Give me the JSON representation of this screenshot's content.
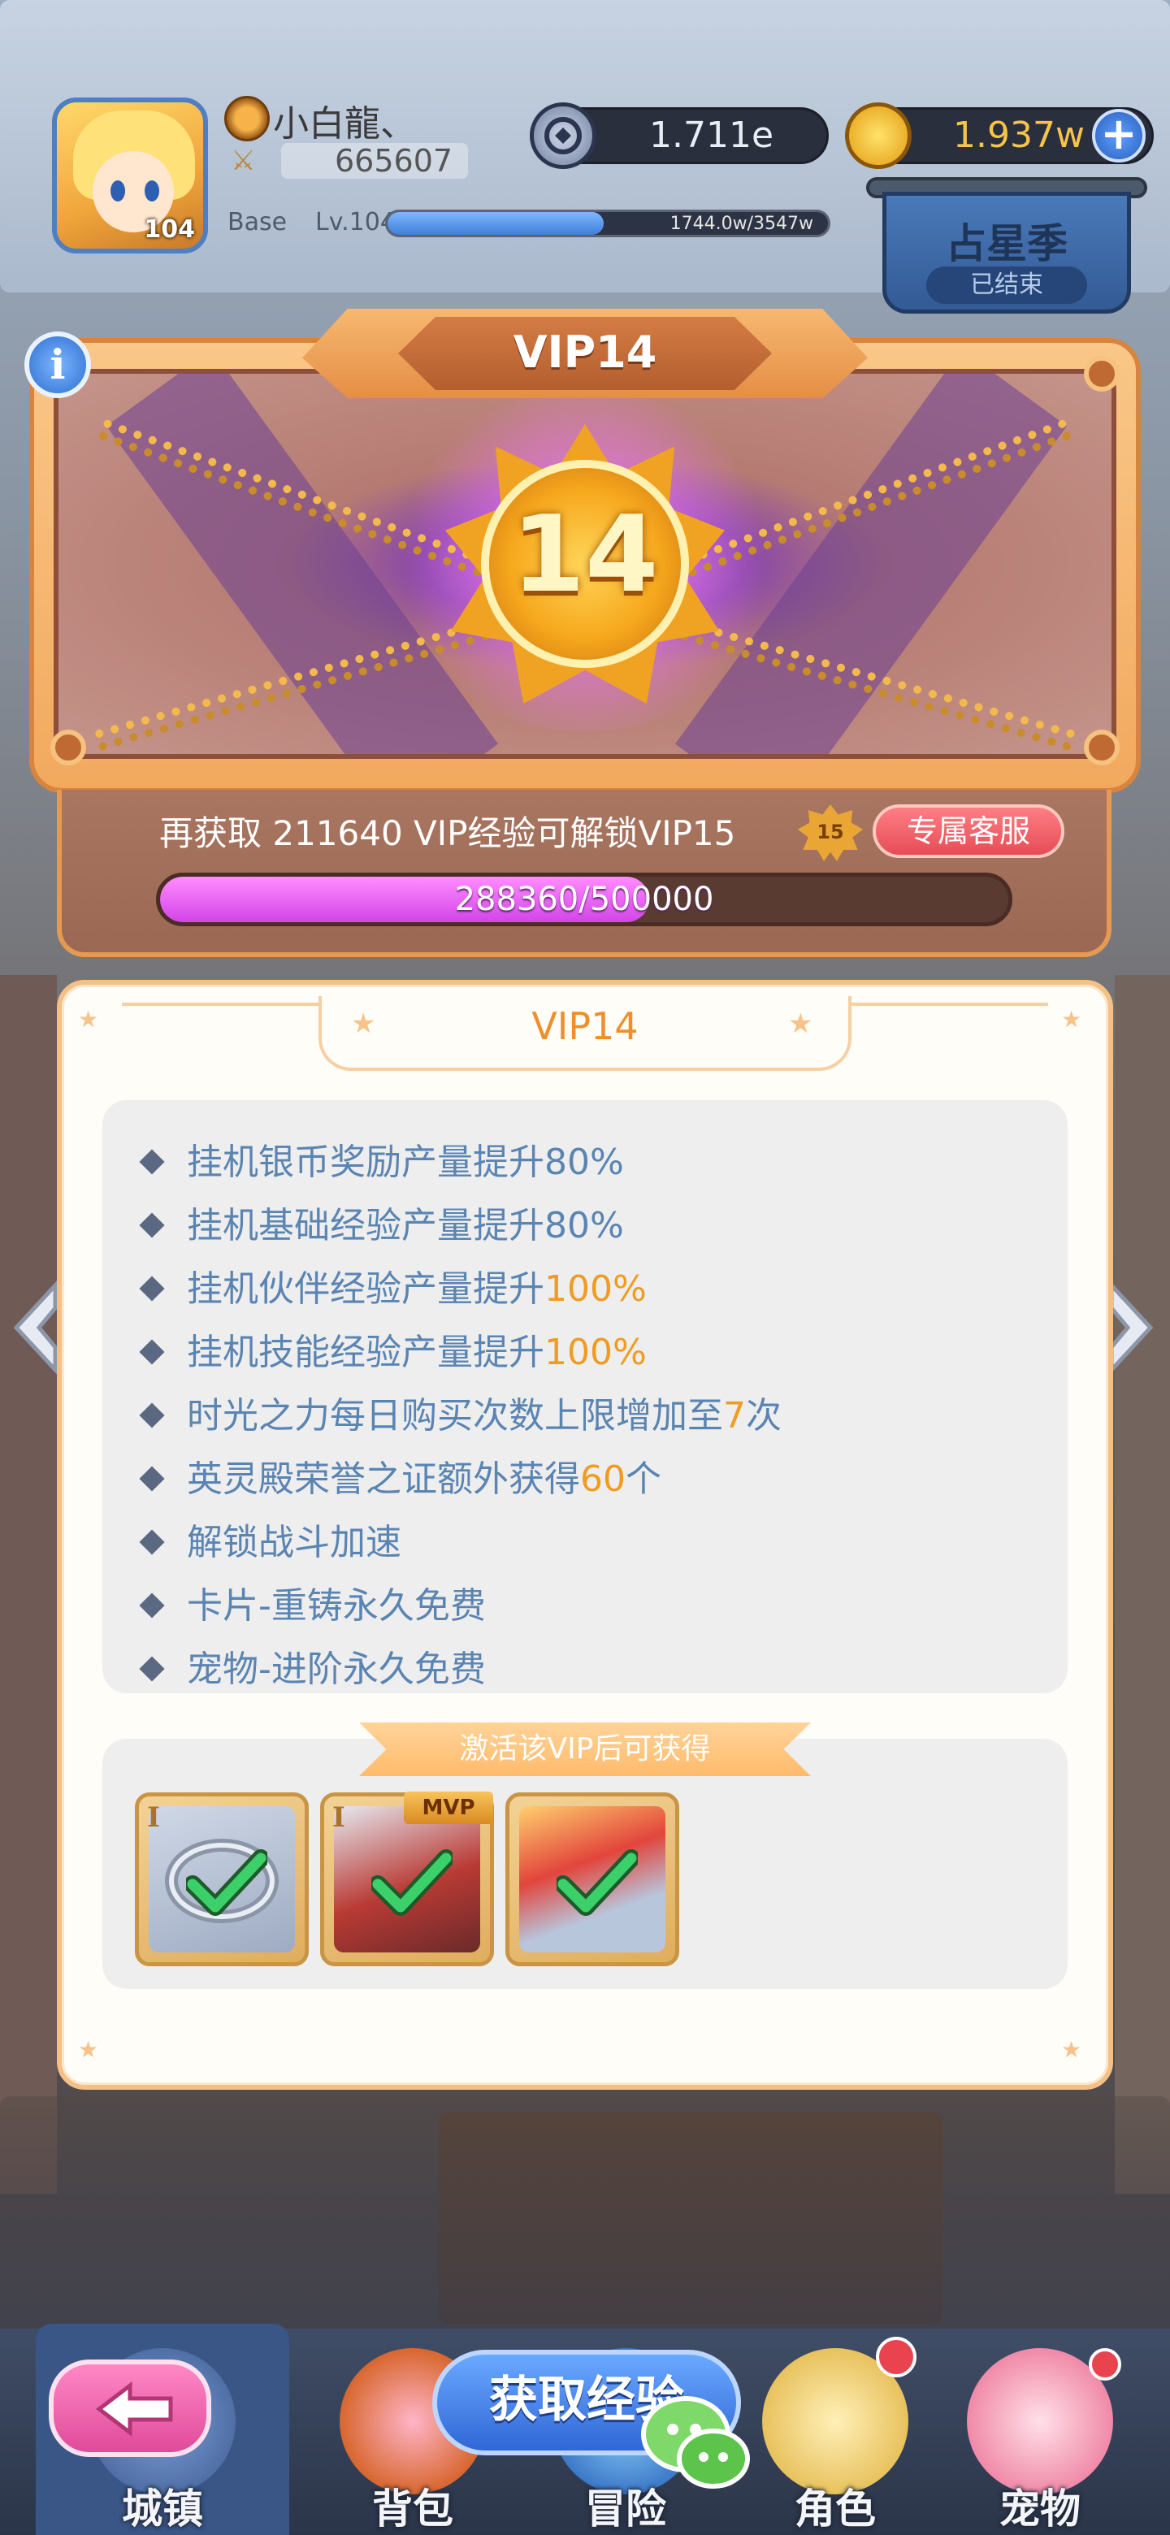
{
  "player": {
    "name": "小白龍、",
    "power": "665607",
    "level_badge": "104",
    "base_label": "Base",
    "level_label": "Lv.104",
    "exp_text": "1744.0w/3547w",
    "exp_fraction": 0.49
  },
  "resources": {
    "diamond": "1.711e",
    "gold": "1.937w",
    "plus_label": "+"
  },
  "season": {
    "title": "占星季",
    "status": "已结束"
  },
  "vip_header": {
    "title": "VIP14",
    "medal_number": "14",
    "info_label": "i",
    "unlock_text": "再获取 211640 VIP经验可解锁VIP15",
    "next_badge": "15",
    "service_button": "专属客服",
    "progress_text": "288360/500000",
    "progress_fraction": 0.57672
  },
  "card": {
    "title": "VIP14",
    "perks": [
      {
        "text": "挂机银币奖励产量提升80%",
        "highlight": ""
      },
      {
        "text": "挂机基础经验产量提升80%",
        "highlight": ""
      },
      {
        "text": "挂机伙伴经验产量提升",
        "highlight": "100%"
      },
      {
        "text": "挂机技能经验产量提升",
        "highlight": "100%"
      },
      {
        "text": "时光之力每日购买次数上限增加至",
        "highlight": "7",
        "suffix": "次"
      },
      {
        "text": "英灵殿荣誉之证额外获得",
        "highlight": "60",
        "suffix": "个"
      },
      {
        "text": "解锁战斗加速",
        "highlight": ""
      },
      {
        "text": "卡片-重铸永久免费",
        "highlight": ""
      },
      {
        "text": "宠物-进阶永久免费",
        "highlight": ""
      }
    ],
    "rewards_label": "激活该VIP后可获得",
    "rewards": [
      {
        "tier": "I",
        "name": "ring-item-icon",
        "badge": ""
      },
      {
        "tier": "I",
        "name": "mvp-card-icon",
        "badge": "MVP"
      },
      {
        "tier": "",
        "name": "frame-item-icon",
        "badge": ""
      }
    ]
  },
  "get_exp_button": "获取经验",
  "nav": [
    {
      "label": "城镇",
      "icon": "town-icon"
    },
    {
      "label": "背包",
      "icon": "bag-icon"
    },
    {
      "label": "冒险",
      "icon": "adventure-icon"
    },
    {
      "label": "角色",
      "icon": "character-icon"
    },
    {
      "label": "宠物",
      "icon": "pet-icon"
    }
  ],
  "colors": {
    "accent_orange": "#f08f2a",
    "perk_text": "#5a84b2",
    "highlight": "#f09b22",
    "progress_pink": "#d244e8",
    "service_red": "#e74c55"
  }
}
